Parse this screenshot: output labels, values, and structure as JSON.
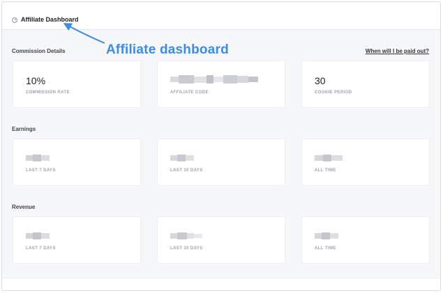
{
  "header": {
    "title": "Affiliate Dashboard",
    "icon": "dashboard-gauge-icon"
  },
  "annotation": {
    "text": "Affiliate dashboard",
    "color": "#3b8be8"
  },
  "commission": {
    "heading": "Commission Details",
    "paid_link": "When will I be paid out?",
    "cards": [
      {
        "value": "10%",
        "caption": "COMMISSION RATE"
      },
      {
        "value": "",
        "caption": "AFFILIATE CODE"
      },
      {
        "value": "30",
        "caption": "COOKIE PERIOD"
      }
    ]
  },
  "earnings": {
    "heading": "Earnings",
    "cards": [
      {
        "caption": "LAST 7 DAYS"
      },
      {
        "caption": "LAST 30 DAYS"
      },
      {
        "caption": "ALL TIME"
      }
    ]
  },
  "revenue": {
    "heading": "Revenue",
    "cards": [
      {
        "caption": "LAST 7 DAYS"
      },
      {
        "caption": "LAST 30 DAYS"
      },
      {
        "caption": "ALL TIME"
      }
    ]
  }
}
